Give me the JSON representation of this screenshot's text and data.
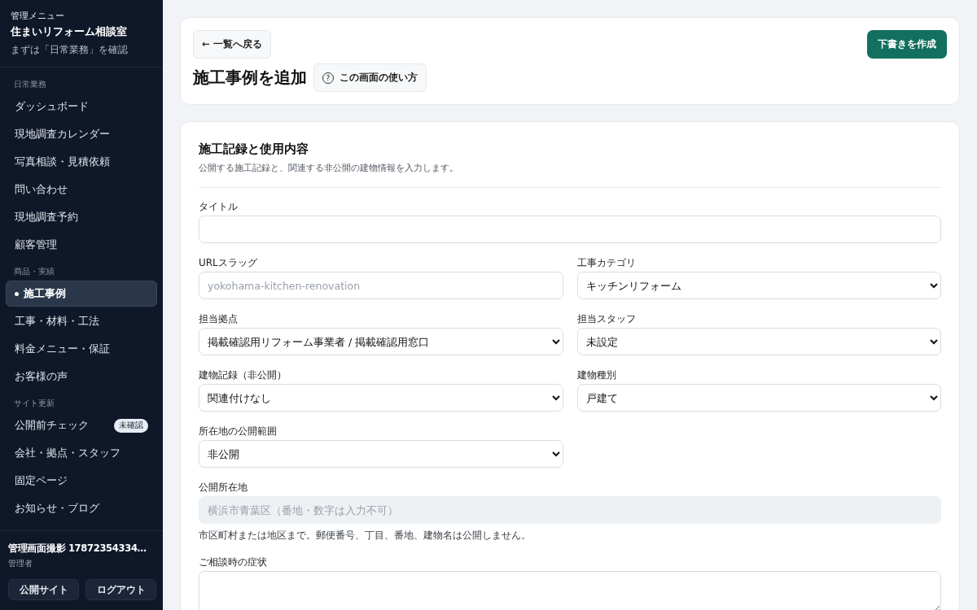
{
  "sidebar": {
    "caption": "管理メニュー",
    "brand": "住まいリフォーム相談室",
    "hint": "まずは「日常業務」を確認",
    "groups": [
      {
        "heading": "日常業務",
        "items": [
          {
            "label": "ダッシュボード",
            "selected": false
          },
          {
            "label": "現地調査カレンダー",
            "selected": false
          },
          {
            "label": "写真相談・見積依頼",
            "selected": false
          },
          {
            "label": "問い合わせ",
            "selected": false
          },
          {
            "label": "現地調査予約",
            "selected": false
          },
          {
            "label": "顧客管理",
            "selected": false
          }
        ]
      },
      {
        "heading": "商品・実績",
        "items": [
          {
            "label": "施工事例",
            "selected": true
          },
          {
            "label": "工事・材料・工法",
            "selected": false
          },
          {
            "label": "料金メニュー・保証",
            "selected": false
          },
          {
            "label": "お客様の声",
            "selected": false
          }
        ]
      },
      {
        "heading": "サイト更新",
        "items": [
          {
            "label": "公開前チェック",
            "selected": false,
            "badge": "未確認"
          },
          {
            "label": "会社・拠点・スタッフ",
            "selected": false
          },
          {
            "label": "固定ページ",
            "selected": false
          },
          {
            "label": "お知らせ・ブログ",
            "selected": false
          }
        ]
      }
    ],
    "user": {
      "name": "管理画面撮影 17872354334…",
      "role": "管理者"
    },
    "buttons": [
      "公開サイト",
      "ログアウト"
    ]
  },
  "header": {
    "back": "← 一覧へ戻る",
    "title": "施工事例を追加",
    "help_icon": "?",
    "help": "この画面の使い方",
    "primary": "下書きを作成"
  },
  "section": {
    "title": "施工記録と使用内容",
    "description": "公開する施工記録と、関連する非公開の建物情報を入力します。",
    "fields": [
      {
        "kind": "text",
        "label": "タイトル",
        "wide": true,
        "disabled": false
      },
      {
        "kind": "text",
        "label": "URLスラッグ",
        "placeholder": "yokohama-kitchen-renovation",
        "wide": false,
        "disabled": false
      },
      {
        "kind": "select",
        "label": "工事カテゴリ",
        "value": "キッチンリフォーム",
        "wide": false
      },
      {
        "kind": "select",
        "label": "担当拠点",
        "value": "掲載確認用リフォーム事業者 / 掲載確認用窓口",
        "wide": false
      },
      {
        "kind": "select",
        "label": "担当スタッフ",
        "value": "未設定",
        "wide": false
      },
      {
        "kind": "select",
        "label": "建物記録（非公開）",
        "value": "関連付けなし",
        "wide": false
      },
      {
        "kind": "select",
        "label": "建物種別",
        "value": "戸建て",
        "wide": false
      },
      {
        "kind": "select",
        "label": "所在地の公開範囲",
        "value": "非公開",
        "wide": false
      },
      {
        "kind": "text",
        "label": "公開所在地",
        "placeholder": "横浜市青葉区（番地・数字は入力不可）",
        "wide": true,
        "disabled": true,
        "note": "市区町村または地区まで。郵便番号、丁目、番地、建物名は公開しません。"
      },
      {
        "kind": "textarea",
        "label": "ご相談時の症状",
        "wide": true
      }
    ]
  }
}
